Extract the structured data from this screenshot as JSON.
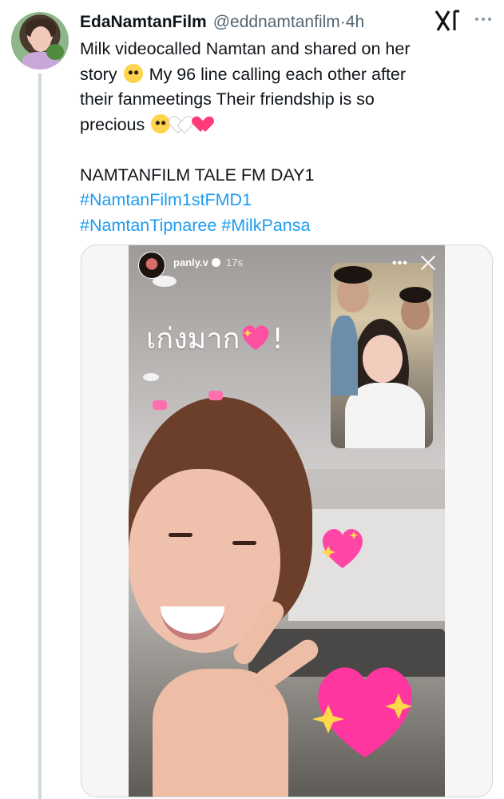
{
  "tweet": {
    "display_name": "EdaNamtanFilm",
    "handle": "@eddnamtanfilm",
    "separator": "·",
    "time": "4h",
    "lines": [
      "Milk videocalled Namtan and shared on her",
      "story",
      "My 96 line calling each other after",
      "their fanmeetings Their friendship is so",
      "precious"
    ],
    "title_line": "NAMTANFILM TALE FM DAY1",
    "hashtags_line1": "#NamtanFilm1stFMD1",
    "hashtags_line2": "#NamtanTipnaree #MilkPansa",
    "icons": [
      "pleading-face-emoji",
      "white-heart-emoji",
      "heart-with-arrow-emoji"
    ]
  },
  "story": {
    "username": "panly.v",
    "time": "17s",
    "menu": "•••",
    "sticker_text": "เก่งมาก",
    "sticker_suffix": "!"
  },
  "colors": {
    "link": "#1d9bf0",
    "text": "#0f1419",
    "secondary": "#536471",
    "thread_line": "#cfd9de"
  }
}
